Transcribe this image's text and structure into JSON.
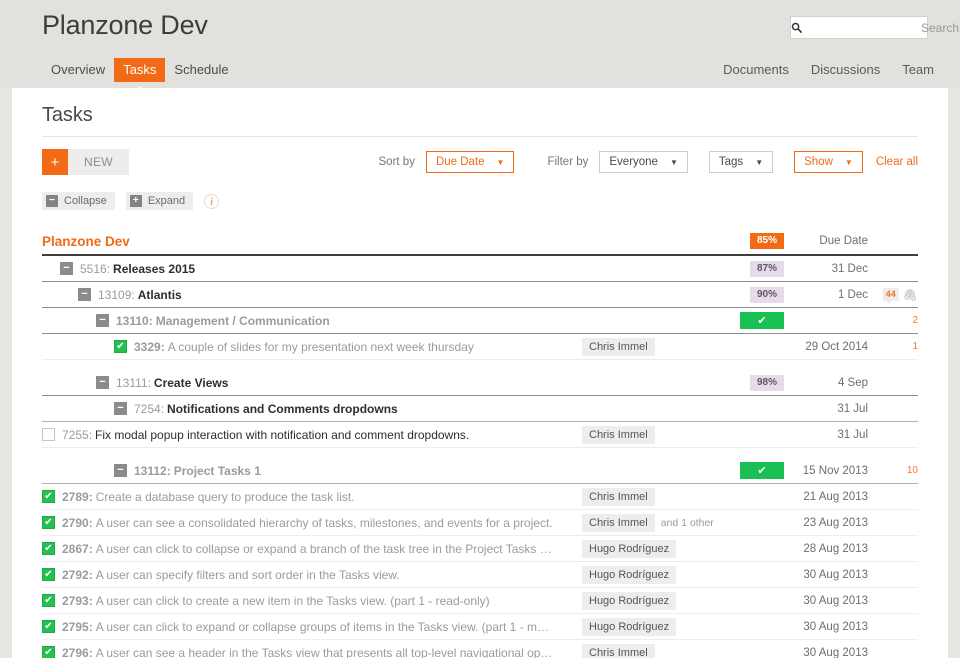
{
  "header": {
    "app_title": "Planzone Dev",
    "nav_left": [
      {
        "label": "Overview",
        "active": false
      },
      {
        "label": "Tasks",
        "active": true
      },
      {
        "label": "Schedule",
        "active": false
      }
    ],
    "nav_right": [
      {
        "label": "Documents"
      },
      {
        "label": "Discussions"
      },
      {
        "label": "Team"
      }
    ],
    "search": {
      "placeholder": "Search",
      "value": "",
      "icon": "search-icon"
    }
  },
  "main": {
    "page_title": "Tasks",
    "new_button": {
      "plus": "+",
      "label": "NEW"
    },
    "sort_label": "Sort by",
    "sort_value": "Due Date",
    "filter_label": "Filter by",
    "filter_value": "Everyone",
    "tags_value": "Tags",
    "show_value": "Show",
    "clear_all": "Clear all",
    "caret": "▼",
    "collapse": {
      "icon": "−",
      "label": "Collapse"
    },
    "expand": {
      "icon": "+",
      "label": "Expand"
    },
    "info_icon": "i"
  },
  "tree": {
    "root": {
      "label": "Planzone Dev",
      "pct": "85%",
      "date_header": "Due Date"
    },
    "rows": [
      {
        "kind": "group",
        "indent": 1,
        "toggle": "−",
        "id": "5516:",
        "title": "Releases 2015",
        "muted": false,
        "pct": "87%",
        "date": "31 Dec",
        "assignee": "",
        "and_other": "",
        "count": "",
        "comments": "",
        "clip": false
      },
      {
        "kind": "group",
        "indent": 2,
        "toggle": "−",
        "id": "13109:",
        "title": "Atlantis",
        "muted": false,
        "pct": "90%",
        "date": "1 Dec",
        "assignee": "",
        "and_other": "",
        "count": "",
        "comments": "44",
        "clip": true
      },
      {
        "kind": "group",
        "indent": 3,
        "toggle": "−",
        "id": "13110:",
        "title": "Management / Communication",
        "muted": true,
        "pct": "",
        "done": true,
        "date": "",
        "assignee": "",
        "and_other": "",
        "count": "2",
        "comments": "",
        "clip": false
      },
      {
        "kind": "task",
        "indent": 4,
        "checked": true,
        "id": "3329:",
        "title": "A couple of slides for my presentation next week thursday",
        "muted": true,
        "pct": "",
        "date": "29 Oct 2014",
        "assignee": "Chris Immel",
        "and_other": "",
        "count": "1",
        "comments": "",
        "clip": false
      },
      {
        "kind": "spacer"
      },
      {
        "kind": "group",
        "indent": 3,
        "toggle": "−",
        "id": "13111:",
        "title": "Create Views",
        "muted": false,
        "pct": "98%",
        "date": "4 Sep",
        "assignee": "",
        "and_other": "",
        "count": "",
        "comments": "",
        "clip": false
      },
      {
        "kind": "group",
        "indent": 4,
        "toggle": "−",
        "id": "7254:",
        "title": "Notifications and Comments dropdowns",
        "muted": false,
        "pct": "",
        "date": "31 Jul",
        "assignee": "",
        "and_other": "",
        "count": "",
        "comments": "",
        "clip": false
      },
      {
        "kind": "task",
        "indent": 5,
        "checked": false,
        "id": "7255:",
        "title": "Fix modal popup interaction with notification and comment dropdowns.",
        "muted": false,
        "pct": "",
        "date": "31 Jul",
        "assignee": "Chris Immel",
        "and_other": "",
        "count": "",
        "comments": "",
        "clip": false
      },
      {
        "kind": "spacer"
      },
      {
        "kind": "group",
        "indent": 4,
        "toggle": "−",
        "id": "13112:",
        "title": "Project Tasks 1",
        "muted": true,
        "pct": "",
        "done": true,
        "date": "15 Nov 2013",
        "assignee": "",
        "and_other": "",
        "count": "10",
        "comments": "",
        "clip": false
      },
      {
        "kind": "task",
        "indent": 5,
        "checked": true,
        "id": "2789:",
        "title": "Create a database query to produce the task list.",
        "muted": true,
        "pct": "",
        "date": "21 Aug 2013",
        "assignee": "Chris Immel",
        "and_other": "",
        "count": "",
        "comments": "",
        "clip": false
      },
      {
        "kind": "task",
        "indent": 5,
        "checked": true,
        "id": "2790:",
        "title": "A user can see a consolidated hierarchy of tasks, milestones, and events for a project.",
        "muted": true,
        "pct": "",
        "date": "23 Aug 2013",
        "assignee": "Chris Immel",
        "and_other": "and 1 other",
        "count": "",
        "comments": "",
        "clip": false
      },
      {
        "kind": "task",
        "indent": 5,
        "checked": true,
        "id": "2867:",
        "title": "A user can click to collapse or expand a branch of the task tree in the Project Tasks …",
        "muted": true,
        "pct": "",
        "date": "28 Aug 2013",
        "assignee": "Hugo Rodríguez",
        "and_other": "",
        "count": "",
        "comments": "",
        "clip": false
      },
      {
        "kind": "task",
        "indent": 5,
        "checked": true,
        "id": "2792:",
        "title": "A user can specify filters and sort order in the Tasks view.",
        "muted": true,
        "pct": "",
        "date": "30 Aug 2013",
        "assignee": "Hugo Rodríguez",
        "and_other": "",
        "count": "",
        "comments": "",
        "clip": false
      },
      {
        "kind": "task",
        "indent": 5,
        "checked": true,
        "id": "2793:",
        "title": "A user can click to create a new item in the Tasks view. (part 1 - read-only)",
        "muted": true,
        "pct": "",
        "date": "30 Aug 2013",
        "assignee": "Hugo Rodríguez",
        "and_other": "",
        "count": "",
        "comments": "",
        "clip": false
      },
      {
        "kind": "task",
        "indent": 5,
        "checked": true,
        "id": "2795:",
        "title": "A user can click to expand or collapse groups of items in the Tasks view. (part 1 - m…",
        "muted": true,
        "pct": "",
        "date": "30 Aug 2013",
        "assignee": "Hugo Rodríguez",
        "and_other": "",
        "count": "",
        "comments": "",
        "clip": false
      },
      {
        "kind": "task",
        "indent": 5,
        "checked": true,
        "id": "2796:",
        "title": "A user can see a header in the Tasks view that presents all top-level navigational op…",
        "muted": true,
        "pct": "",
        "date": "30 Aug 2013",
        "assignee": "Chris Immel",
        "and_other": "",
        "count": "",
        "comments": "",
        "clip": false
      }
    ]
  }
}
